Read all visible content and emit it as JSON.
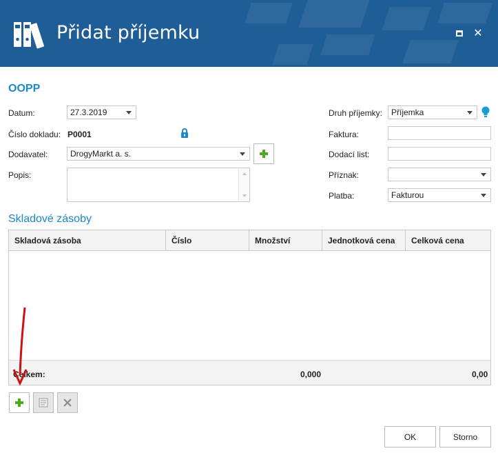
{
  "window": {
    "title": "Přidat příjemku",
    "maximize_icon": "maximize-icon",
    "close_glyph": "✕"
  },
  "form": {
    "code": "OOPP",
    "left": {
      "datum_label": "Datum:",
      "datum_value": "27.3.2019",
      "cislo_label": "Číslo dokladu:",
      "cislo_value": "P0001",
      "dodavatel_label": "Dodavatel:",
      "dodavatel_value": "DrogyMarkt a. s.",
      "popis_label": "Popis:",
      "popis_value": ""
    },
    "right": {
      "druh_label": "Druh příjemky:",
      "druh_value": "Příjemka",
      "faktura_label": "Faktura:",
      "faktura_value": "",
      "dodaci_label": "Dodací list:",
      "dodaci_value": "",
      "priznak_label": "Příznak:",
      "priznak_value": "",
      "platba_label": "Platba:",
      "platba_value": "Fakturou"
    }
  },
  "stock": {
    "section_title": "Skladové zásoby",
    "columns": [
      "Skladová zásoba",
      "Číslo",
      "Množství",
      "Jednotková cena",
      "Celková cena"
    ],
    "rows": [],
    "totals": {
      "label": "Celkem:",
      "quantity": "0,000",
      "total_price": "0,00"
    }
  },
  "buttons": {
    "ok": "OK",
    "cancel": "Storno"
  },
  "colors": {
    "header_bg": "#1f5d96",
    "accent": "#1a88c9",
    "plus_green": "#4caa21",
    "annotation_arrow": "#cc1111"
  }
}
